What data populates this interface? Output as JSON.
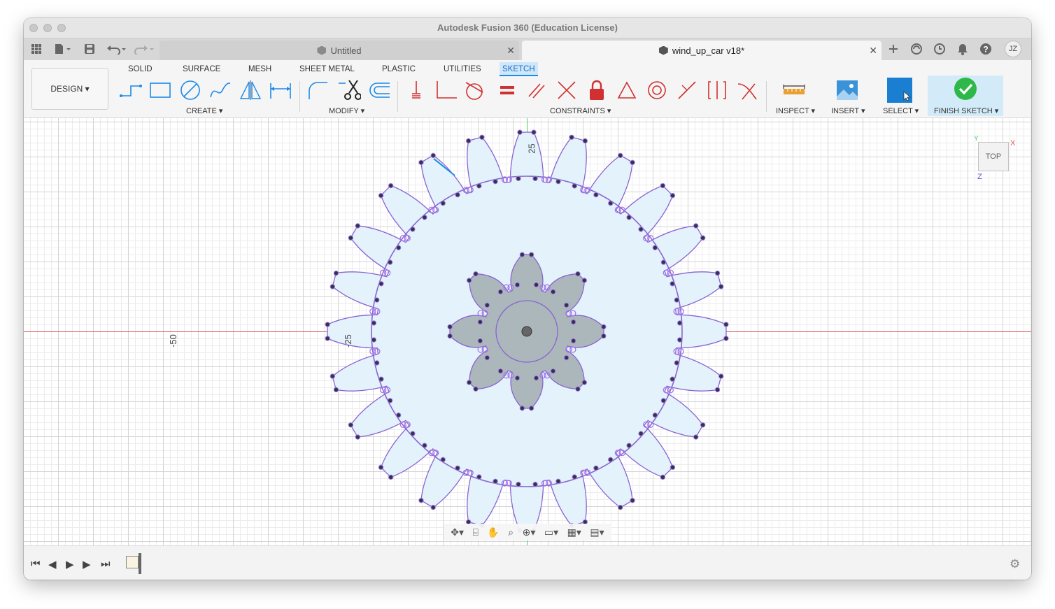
{
  "window": {
    "title": "Autodesk Fusion 360 (Education License)"
  },
  "tabs": [
    {
      "label": "Untitled",
      "active": false
    },
    {
      "label": "wind_up_car v18*",
      "active": true
    }
  ],
  "user": {
    "initials": "JZ"
  },
  "workspace": {
    "label": "DESIGN ▾"
  },
  "toolbar_tabs": [
    "SOLID",
    "SURFACE",
    "MESH",
    "SHEET METAL",
    "PLASTIC",
    "UTILITIES",
    "SKETCH"
  ],
  "active_toolbar_tab": "SKETCH",
  "tool_groups": {
    "create": "CREATE ▾",
    "modify": "MODIFY ▾",
    "constraints": "CONSTRAINTS ▾",
    "inspect": "INSPECT ▾",
    "insert": "INSERT ▾",
    "select": "SELECT ▾",
    "finish": "FINISH SKETCH ▾"
  },
  "icons": {
    "create": [
      "line-icon",
      "rectangle-icon",
      "circle-icon",
      "spline-icon",
      "mirror-icon",
      "dimension-icon"
    ],
    "modify": [
      "fillet-icon",
      "trim-icon",
      "offset-icon"
    ],
    "constraints": [
      "coincident-icon",
      "collinear-icon",
      "tangent-icon",
      "equal-icon",
      "parallel-icon",
      "perpendicular-icon",
      "fix-icon",
      "midpoint-icon",
      "concentric-icon",
      "symmetry-icon",
      "horizontal-vertical-icon",
      "smooth-icon"
    ]
  },
  "canvas": {
    "dimension_labels": {
      "top": "25",
      "left": "-50",
      "mid": "-25"
    },
    "view_cube": {
      "face": "TOP",
      "x_axis": "X",
      "y_axis": "Y",
      "z_axis": "Z"
    }
  },
  "colors": {
    "accent": "#1b8ae8",
    "sketch_line": "#8a63d2",
    "profile_fill": "#e4f3fb",
    "inner_fill": "#9aa3a6",
    "axis_x": "#e05a5a",
    "axis_y": "#4fcf6a",
    "finish_green": "#2eb84a"
  },
  "gear": {
    "outer_teeth": 24,
    "inner_teeth": 8
  }
}
